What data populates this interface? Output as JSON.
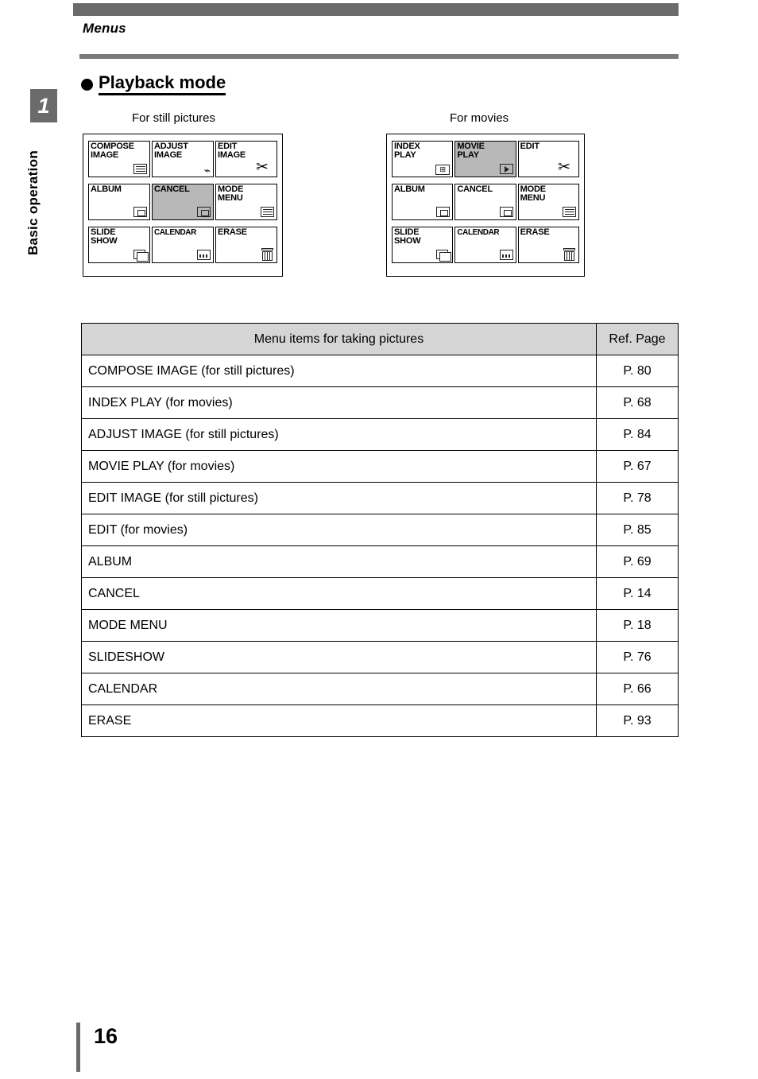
{
  "header": {
    "running_title": "Menus"
  },
  "chapter": {
    "number": "1",
    "label": "Basic operation"
  },
  "section": {
    "title": "Playback mode"
  },
  "figures": {
    "still_caption": "For still pictures",
    "movies_caption": "For movies",
    "still_items": [
      {
        "label": "COMPOSE\nIMAGE",
        "selected": false,
        "icon": "grid-icon"
      },
      {
        "label": "ADJUST\nIMAGE",
        "selected": false,
        "icon": "sliders-icon"
      },
      {
        "label": "EDIT\nIMAGE",
        "selected": false,
        "icon": "scissors-icon"
      },
      {
        "label": "ALBUM",
        "selected": false,
        "icon": "album-icon"
      },
      {
        "label": "CANCEL",
        "selected": true,
        "icon": "cancel-icon"
      },
      {
        "label": "MODE\nMENU",
        "selected": false,
        "icon": "menu-lines-icon"
      },
      {
        "label": "SLIDE\nSHOW",
        "selected": false,
        "icon": "slideshow-icon"
      },
      {
        "label": "CALENDAR",
        "selected": false,
        "icon": "calendar-icon"
      },
      {
        "label": "ERASE",
        "selected": false,
        "icon": "trash-icon"
      }
    ],
    "movie_items": [
      {
        "label": "INDEX\nPLAY",
        "selected": false,
        "icon": "index-play-icon"
      },
      {
        "label": "MOVIE\nPLAY",
        "selected": true,
        "icon": "movie-play-icon"
      },
      {
        "label": "EDIT",
        "selected": false,
        "icon": "scissors-icon"
      },
      {
        "label": "ALBUM",
        "selected": false,
        "icon": "album-icon"
      },
      {
        "label": "CANCEL",
        "selected": false,
        "icon": "cancel-icon"
      },
      {
        "label": "MODE\nMENU",
        "selected": false,
        "icon": "menu-lines-icon"
      },
      {
        "label": "SLIDE\nSHOW",
        "selected": false,
        "icon": "slideshow-icon"
      },
      {
        "label": "CALENDAR",
        "selected": false,
        "icon": "calendar-icon"
      },
      {
        "label": "ERASE",
        "selected": false,
        "icon": "trash-icon"
      }
    ]
  },
  "table": {
    "headers": [
      "Menu items for taking pictures",
      "Ref. Page"
    ],
    "rows": [
      {
        "item": "COMPOSE IMAGE (for still pictures)",
        "ref": "P. 80"
      },
      {
        "item": "INDEX PLAY (for movies)",
        "ref": "P. 68"
      },
      {
        "item": "ADJUST IMAGE (for still pictures)",
        "ref": "P. 84"
      },
      {
        "item": "MOVIE PLAY (for movies)",
        "ref": "P. 67"
      },
      {
        "item": "EDIT IMAGE (for still pictures)",
        "ref": "P. 78"
      },
      {
        "item": "EDIT (for movies)",
        "ref": "P. 85"
      },
      {
        "item": "ALBUM",
        "ref": "P. 69"
      },
      {
        "item": "CANCEL",
        "ref": "P. 14"
      },
      {
        "item": "MODE MENU",
        "ref": "P. 18"
      },
      {
        "item": "SLIDESHOW",
        "ref": "P. 76"
      },
      {
        "item": "CALENDAR",
        "ref": "P. 66"
      },
      {
        "item": "ERASE",
        "ref": "P. 93"
      }
    ]
  },
  "footer": {
    "page_number": "16"
  }
}
